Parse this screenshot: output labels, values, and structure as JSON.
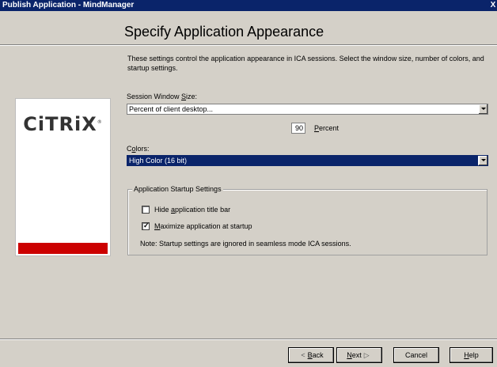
{
  "window": {
    "title": "Publish Application - MindManager",
    "close_glyph": "X"
  },
  "page": {
    "title": "Specify Application Appearance",
    "description": "These settings control the application appearance in ICA sessions.  Select the window size, number of colors, and startup settings."
  },
  "logo": {
    "text": "CiTRiX",
    "reg": "®",
    "accent_color": "#cc0000"
  },
  "session_window": {
    "label_pre": "Session Window ",
    "label_u": "S",
    "label_post": "ize:",
    "value": "Percent of client desktop...",
    "percent_value": "90",
    "percent_label_u": "P",
    "percent_label_post": "ercent"
  },
  "colors": {
    "label_pre": "C",
    "label_u": "o",
    "label_post": "lors:",
    "value": "High Color (16 bit)"
  },
  "startup": {
    "legend": "Application Startup Settings",
    "hide_title_bar": {
      "pre": "Hide ",
      "u": "a",
      "post": "pplication title bar",
      "checked": false
    },
    "maximize": {
      "pre": "",
      "u": "M",
      "post": "aximize application at startup",
      "checked": true,
      "mark": "✓"
    },
    "note": "Note: Startup settings are ignored in seamless mode ICA sessions."
  },
  "buttons": {
    "back": {
      "glyph": "<",
      "u": "B",
      "post": "ack"
    },
    "next": {
      "u": "N",
      "post": "ext",
      "glyph": "▷"
    },
    "cancel": "Cancel",
    "help": {
      "u": "H",
      "post": "elp"
    }
  },
  "icons": {
    "combo_dropdown": "chevron-down-icon",
    "back_arrow": "back-arrow-icon",
    "next_arrow": "next-arrow-icon",
    "close": "close-icon"
  }
}
